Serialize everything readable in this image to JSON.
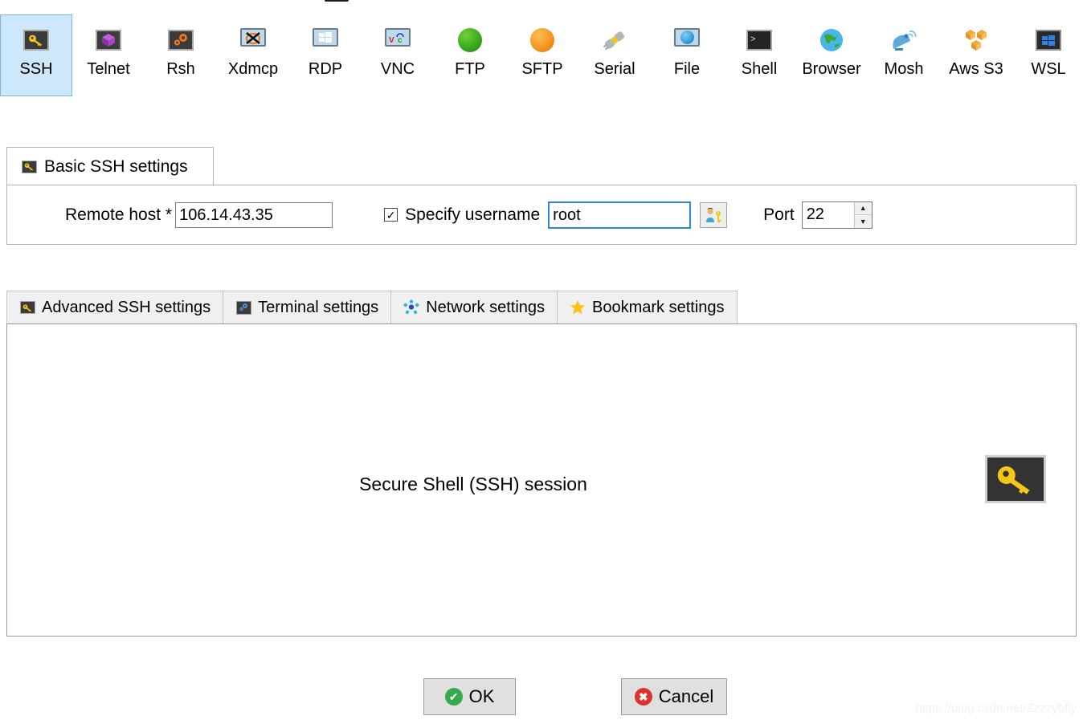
{
  "session_types": [
    {
      "label": "SSH",
      "icon": "key-icon",
      "selected": true
    },
    {
      "label": "Telnet",
      "icon": "purple-cube-icon",
      "selected": false
    },
    {
      "label": "Rsh",
      "icon": "orange-gears-icon",
      "selected": false
    },
    {
      "label": "Xdmcp",
      "icon": "x-monitor-icon",
      "selected": false
    },
    {
      "label": "RDP",
      "icon": "windows-monitor-icon",
      "selected": false
    },
    {
      "label": "VNC",
      "icon": "vnc-monitor-icon",
      "selected": false
    },
    {
      "label": "FTP",
      "icon": "green-globe-icon",
      "selected": false
    },
    {
      "label": "SFTP",
      "icon": "orange-globe-icon",
      "selected": false
    },
    {
      "label": "Serial",
      "icon": "plug-icon",
      "selected": false
    },
    {
      "label": "File",
      "icon": "globe-monitor-icon",
      "selected": false
    },
    {
      "label": "Shell",
      "icon": "terminal-prompt-icon",
      "selected": false
    },
    {
      "label": "Browser",
      "icon": "blue-globe-icon",
      "selected": false
    },
    {
      "label": "Mosh",
      "icon": "satellite-dish-icon",
      "selected": false
    },
    {
      "label": "Aws S3",
      "icon": "aws-cubes-icon",
      "selected": false
    },
    {
      "label": "WSL",
      "icon": "windows-logo-icon",
      "selected": false
    }
  ],
  "basic_settings": {
    "group_title": "Basic SSH settings",
    "group_icon": "key-icon",
    "remote_host_label": "Remote host *",
    "remote_host_value": "106.14.43.35",
    "specify_username_label": "Specify username",
    "specify_username_checked": true,
    "checkbox_glyph": "✓",
    "username_value": "root",
    "user_button_icon": "user-key-icon",
    "port_label": "Port",
    "port_value": "22",
    "spinner_up_glyph": "▲",
    "spinner_down_glyph": "▼"
  },
  "secondary_tabs": [
    {
      "label": "Advanced SSH settings",
      "icon": "key-icon"
    },
    {
      "label": "Terminal settings",
      "icon": "terminal-gears-icon"
    },
    {
      "label": "Network settings",
      "icon": "network-nodes-icon"
    },
    {
      "label": "Bookmark settings",
      "icon": "star-icon"
    }
  ],
  "content": {
    "session_caption": "Secure Shell (SSH) session",
    "big_icon": "key-icon"
  },
  "footer": {
    "ok_label": "OK",
    "ok_icon": "check-circle-icon",
    "ok_glyph": "✔",
    "cancel_label": "Cancel",
    "cancel_icon": "x-circle-icon",
    "cancel_glyph": "✖"
  },
  "watermark": "https://blog.csdn.net/Zzzzybfly",
  "colors": {
    "selection_bg": "#cde8fb",
    "selection_border": "#7eb4ea",
    "focus_border": "#2c8ad6",
    "tab_bg": "#f0f0f0",
    "ok_green": "#35ab4d",
    "cancel_red": "#e03030",
    "key_yellow": "#f5c518"
  }
}
